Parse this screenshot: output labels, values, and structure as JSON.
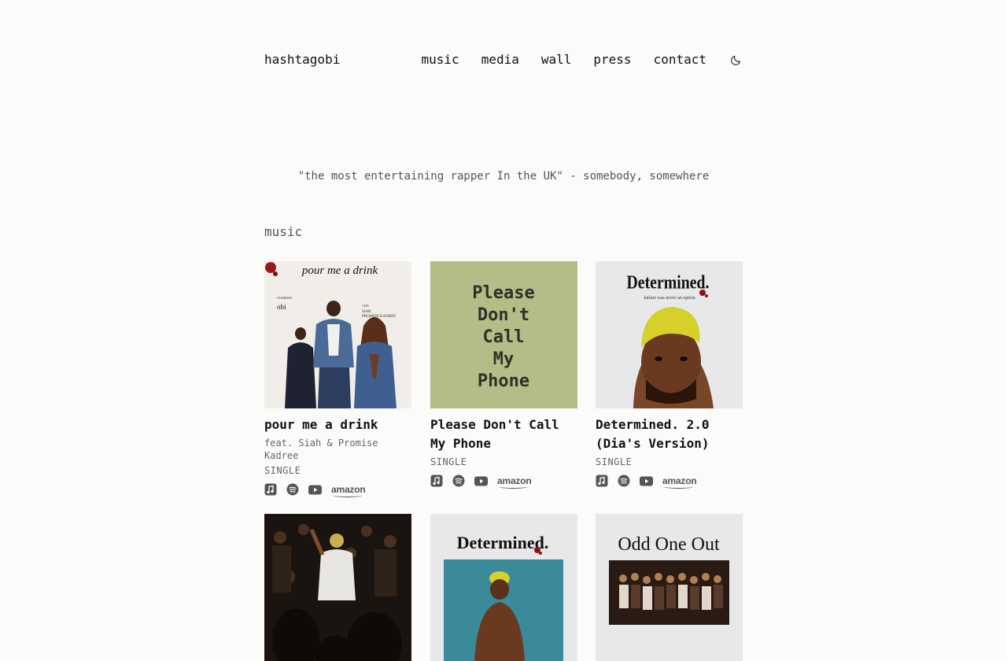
{
  "header": {
    "brand": "hashtagobi",
    "nav": [
      "music",
      "media",
      "wall",
      "press",
      "contact"
    ],
    "theme_icon": "moon-icon"
  },
  "quote": "\"the most entertaining rapper In the UK\" - somebody, somewhere",
  "section_title": "music",
  "colors": {
    "background": "#fbfbf9",
    "text": "#111111",
    "muted": "#666666"
  },
  "releases": [
    {
      "title": "pour me a drink",
      "feat": "feat. Siah & Promise Kadree",
      "type": "SINGLE",
      "cover_text": "pour me a drink",
      "cover_sub_left": "STARRING",
      "cover_name": "obi",
      "cover_sub_right": "AND",
      "cover_names_right": "SIAH\nPROMISE KADREE"
    },
    {
      "title": "Please Don't Call My Phone",
      "type": "SINGLE",
      "cover_text": "Please Don't Call My Phone"
    },
    {
      "title": "Determined. 2.0 (Dia's Version)",
      "type": "SINGLE",
      "cover_text": "Determined.",
      "cover_sub": "failure was never an option"
    },
    {
      "title": "",
      "type": ""
    },
    {
      "title": "",
      "type": "",
      "cover_text": "Determined."
    },
    {
      "title": "",
      "type": "",
      "cover_text": "Odd One Out"
    }
  ],
  "streaming_icons": [
    "apple-music-icon",
    "spotify-icon",
    "youtube-icon",
    "amazon-icon"
  ],
  "amazon_label": "amazon"
}
